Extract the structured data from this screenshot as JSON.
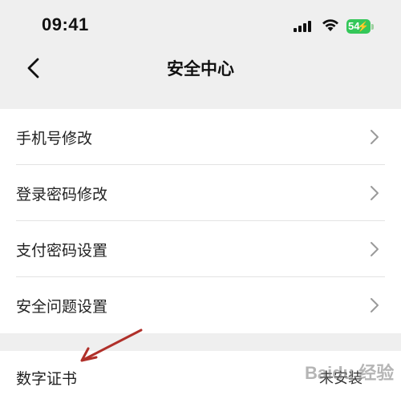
{
  "status_bar": {
    "time": "09:41",
    "battery": "54",
    "battery_color": "#34c759"
  },
  "nav": {
    "title": "安全中心",
    "back_icon": "chevron-left-icon"
  },
  "menu": {
    "items": [
      {
        "label": "手机号修改"
      },
      {
        "label": "登录密码修改"
      },
      {
        "label": "支付密码设置"
      },
      {
        "label": "安全问题设置"
      }
    ]
  },
  "certificate": {
    "label": "数字证书",
    "status": "未安装"
  },
  "annotation": {
    "arrow_color": "#b0302a"
  },
  "watermark": "Baidu 经验"
}
